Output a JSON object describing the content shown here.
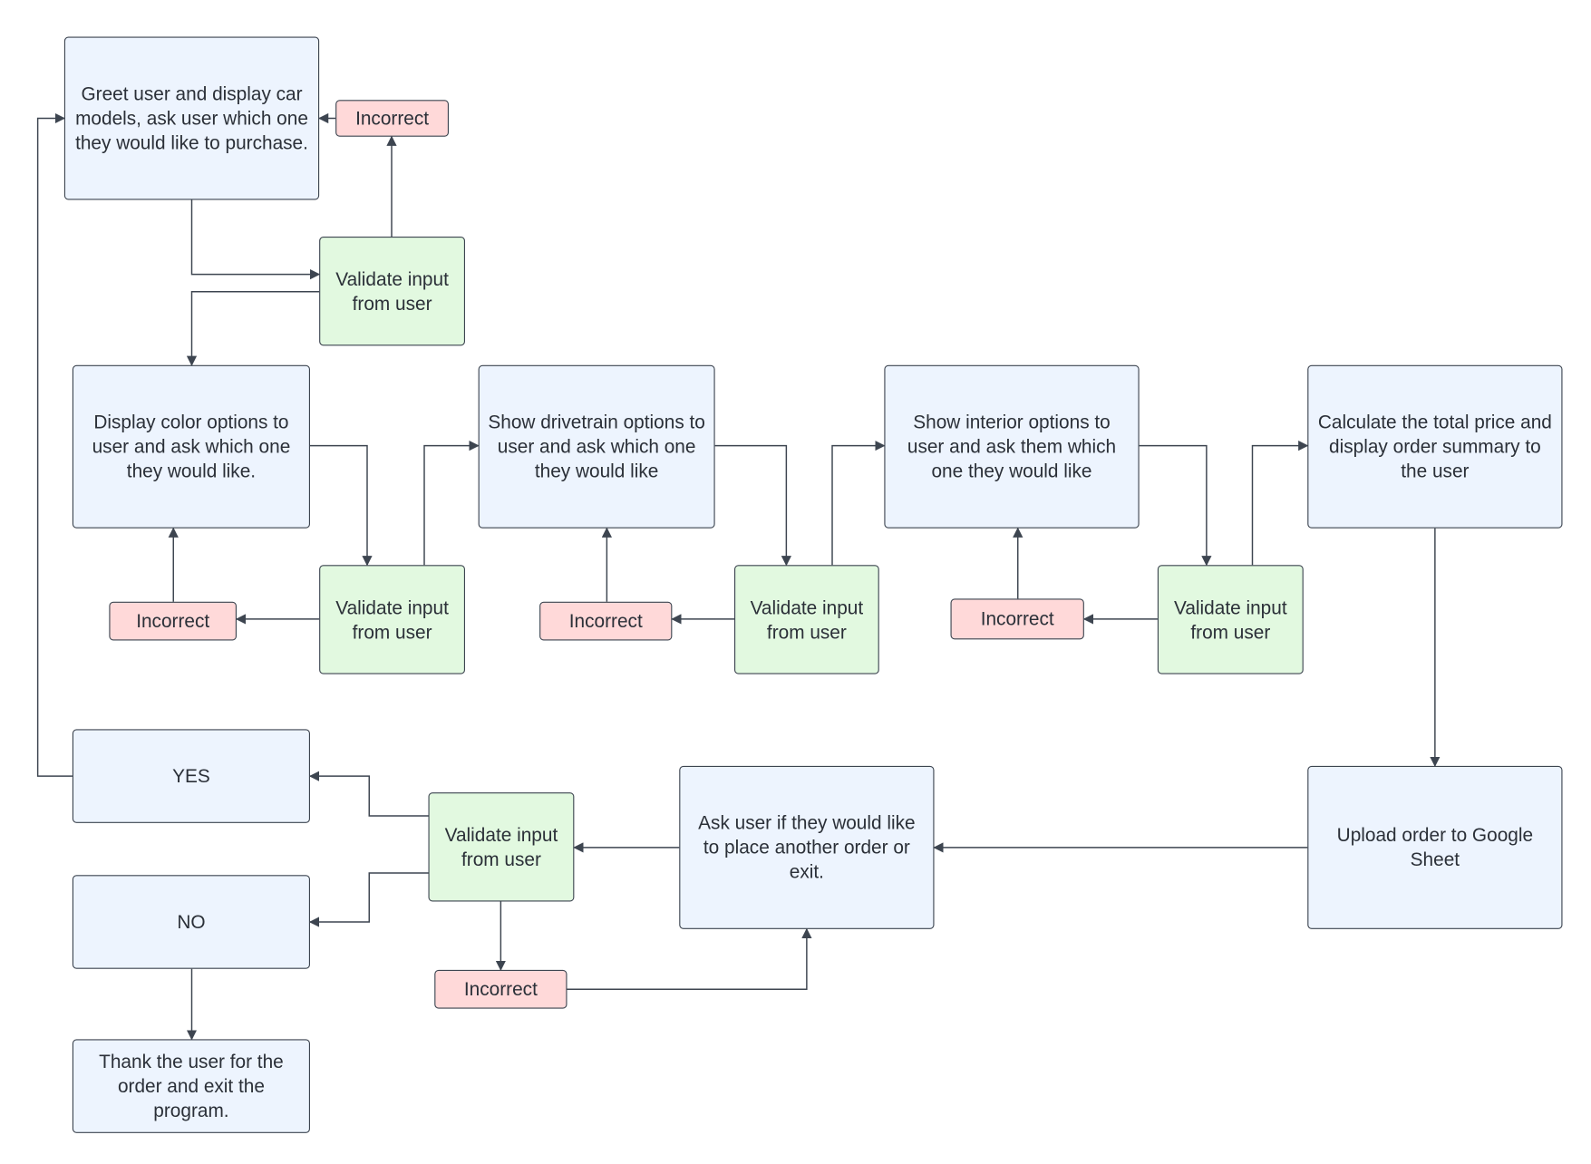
{
  "colors": {
    "process": "#edf4fe",
    "validate": "#e2f9e0",
    "incorrect": "#ffd9d9",
    "stroke": "#3d4550"
  },
  "nodes": {
    "greet": "Greet user and display car models, ask user which one they would like to purchase.",
    "incorrect_1": "Incorrect",
    "validate_1": "Validate input from user",
    "color": "Display color options to user and ask which one they would like.",
    "validate_2": "Validate input from user",
    "incorrect_2": "Incorrect",
    "drivetrain": "Show drivetrain options to user and ask which one they would like",
    "validate_3": "Validate input from user",
    "incorrect_3": "Incorrect",
    "interior": "Show interior options to user and ask them which one they would like",
    "validate_4": "Validate input from user",
    "incorrect_4": "Incorrect",
    "calculate": "Calculate the total price and display order summary to the user",
    "upload": "Upload order to Google Sheet",
    "ask_again": "Ask user if they would like to place another order or exit.",
    "validate_5": "Validate input from user",
    "incorrect_5": "Incorrect",
    "yes": "YES",
    "no": "NO",
    "thank": "Thank the user for the order and exit the program."
  },
  "edges": [
    [
      "greet",
      "validate_1"
    ],
    [
      "validate_1",
      "incorrect_1"
    ],
    [
      "incorrect_1",
      "greet"
    ],
    [
      "validate_1",
      "color"
    ],
    [
      "color",
      "validate_2"
    ],
    [
      "validate_2",
      "incorrect_2"
    ],
    [
      "incorrect_2",
      "color"
    ],
    [
      "validate_2",
      "drivetrain"
    ],
    [
      "drivetrain",
      "validate_3"
    ],
    [
      "validate_3",
      "incorrect_3"
    ],
    [
      "incorrect_3",
      "drivetrain"
    ],
    [
      "validate_3",
      "interior"
    ],
    [
      "interior",
      "validate_4"
    ],
    [
      "validate_4",
      "incorrect_4"
    ],
    [
      "incorrect_4",
      "interior"
    ],
    [
      "validate_4",
      "calculate"
    ],
    [
      "calculate",
      "upload"
    ],
    [
      "upload",
      "ask_again"
    ],
    [
      "ask_again",
      "validate_5"
    ],
    [
      "validate_5",
      "incorrect_5"
    ],
    [
      "incorrect_5",
      "ask_again"
    ],
    [
      "validate_5",
      "yes"
    ],
    [
      "validate_5",
      "no"
    ],
    [
      "no",
      "thank"
    ],
    [
      "yes",
      "greet"
    ]
  ]
}
